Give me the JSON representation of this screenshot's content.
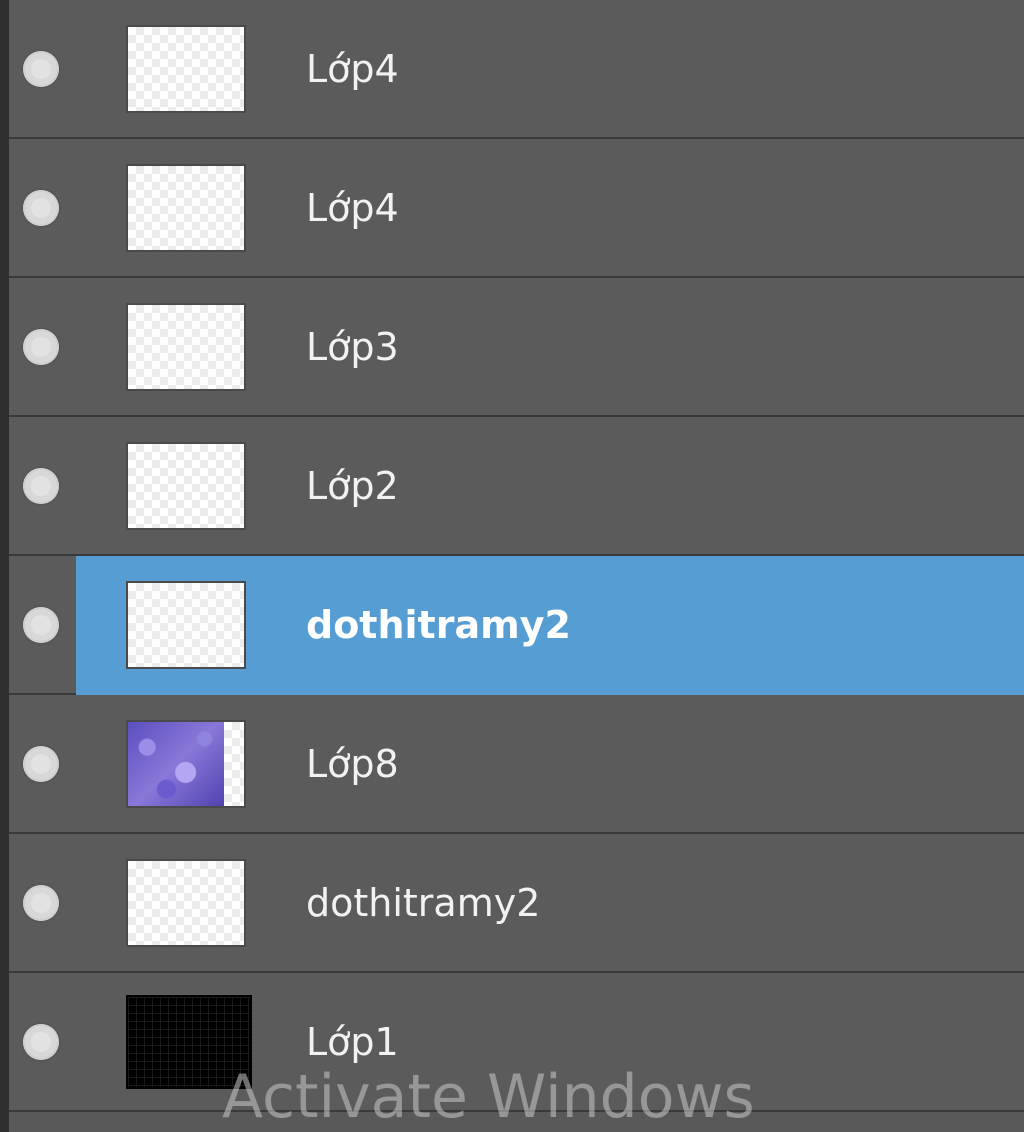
{
  "layers": [
    {
      "name": "Lớp4",
      "thumbnail": "transparent",
      "selected": false
    },
    {
      "name": "Lớp4",
      "thumbnail": "transparent",
      "selected": false
    },
    {
      "name": "Lớp3",
      "thumbnail": "transparent",
      "selected": false
    },
    {
      "name": "Lớp2",
      "thumbnail": "transparent",
      "selected": false
    },
    {
      "name": "dothitramy2",
      "thumbnail": "transparent",
      "selected": true
    },
    {
      "name": "Lớp8",
      "thumbnail": "purple-texture",
      "selected": false
    },
    {
      "name": "dothitramy2",
      "thumbnail": "transparent",
      "selected": false
    },
    {
      "name": "Lớp1",
      "thumbnail": "black-fill",
      "selected": false
    }
  ],
  "watermark": "Activate Windows",
  "colors": {
    "panel_bg": "#5b5b5b",
    "selected_bg": "#569dd3",
    "divider": "#3a3a3a"
  }
}
